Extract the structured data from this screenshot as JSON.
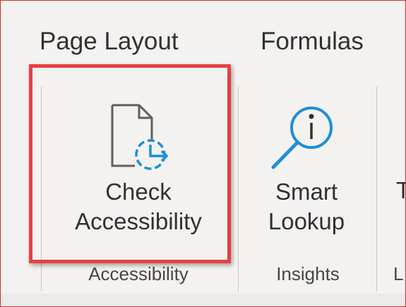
{
  "tabs": [
    {
      "label": "Page Layout"
    },
    {
      "label": "Formulas"
    }
  ],
  "commands": {
    "check_accessibility": {
      "line1": "Check",
      "line2": "Accessibility",
      "icon": "check-accessibility-icon"
    },
    "smart_lookup": {
      "line1": "Smart",
      "line2": "Lookup",
      "icon": "smart-lookup-icon"
    }
  },
  "groups": {
    "accessibility": "Accessibility",
    "insights": "Insights"
  },
  "colors": {
    "highlight": "#e8403f",
    "icon_blue": "#1e8fd6",
    "icon_gray": "#605e5c"
  }
}
